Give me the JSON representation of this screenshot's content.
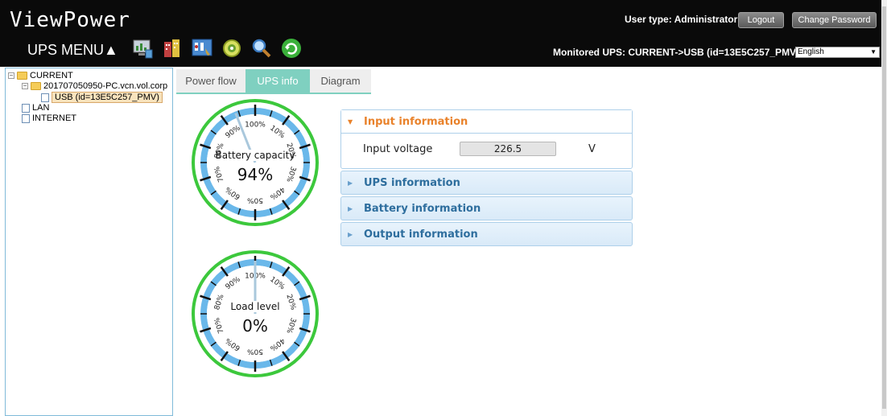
{
  "header": {
    "brand": "ViewPower",
    "menu_label": "UPS MENU▲",
    "user_type": "User type: Administrator",
    "logout_label": "Logout",
    "change_password_label": "Change Password",
    "monitored": "Monitored UPS: CURRENT->USB (id=13E5C257_PMV)",
    "language": "English",
    "icons": [
      "monitor-chart-icon",
      "building-icon",
      "control-panel-icon",
      "gear-icon",
      "search-icon",
      "refresh-icon"
    ]
  },
  "tree": {
    "root": "CURRENT",
    "host": "201707050950-PC.vcn.vol.corp",
    "device": "USB (id=13E5C257_PMV)",
    "lan": "LAN",
    "internet": "INTERNET"
  },
  "tabs": [
    "Power flow",
    "UPS info",
    "Diagram"
  ],
  "active_tab": "UPS info",
  "gauges": [
    {
      "label": "Battery capacity",
      "value_text": "94%",
      "value": 94
    },
    {
      "label": "Load level",
      "value_text": "0%",
      "value": 0
    }
  ],
  "gauge_ticks": [
    "100%",
    "10%",
    "20%",
    "30%",
    "40%",
    "50%",
    "60%",
    "70%",
    "80%",
    "90%"
  ],
  "accordion": {
    "input": {
      "title": "Input information",
      "field_label": "Input voltage",
      "field_value": "226.5",
      "unit": "V"
    },
    "ups": {
      "title": "UPS information"
    },
    "battery": {
      "title": "Battery information"
    },
    "output": {
      "title": "Output information"
    }
  },
  "colors": {
    "header_bg": "#0a0a0a",
    "tab_active": "#7fd0c0",
    "gauge_ring": "#3cc83c",
    "gauge_band": "#6ab8ea",
    "accent_orange": "#e9822b",
    "accordion_text": "#2e6e9e"
  }
}
